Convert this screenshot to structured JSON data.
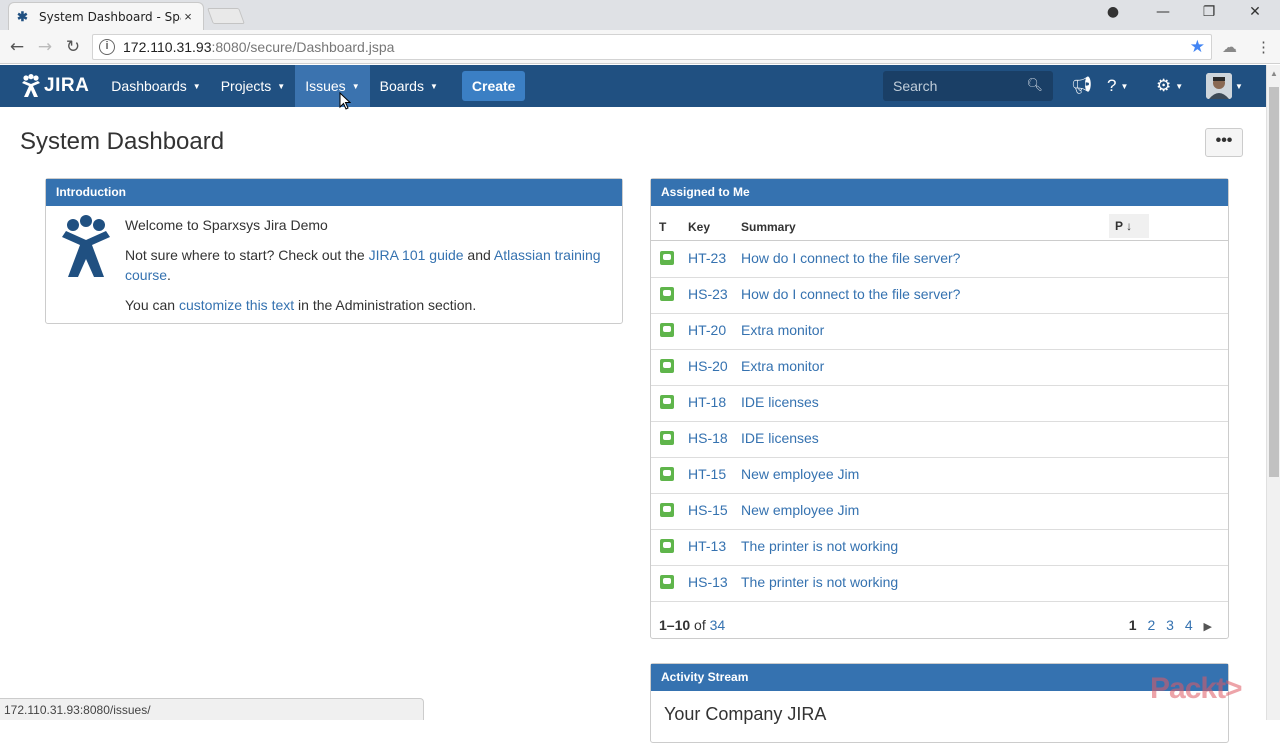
{
  "browser": {
    "tab_title": "System Dashboard - Spa",
    "tab_close": "×",
    "url_host": "172.110.31.93",
    "url_path": ":8080/secure/Dashboard.jspa",
    "status_url": "172.110.31.93:8080/issues/"
  },
  "header": {
    "logo": "JIRA",
    "nav": [
      {
        "label": "Dashboards"
      },
      {
        "label": "Projects"
      },
      {
        "label": "Issues"
      },
      {
        "label": "Boards"
      }
    ],
    "create_label": "Create",
    "search_placeholder": "Search",
    "colors": {
      "bar": "#205081",
      "active": "#3b73af",
      "create": "#3b7fc4"
    }
  },
  "page": {
    "title": "System Dashboard",
    "more_label": "•••"
  },
  "introduction": {
    "heading": "Introduction",
    "welcome": "Welcome to Sparxsys Jira Demo",
    "line2_a": "Not sure where to start? Check out the ",
    "link_guide": "JIRA 101 guide",
    "line2_b": " and ",
    "link_training": "Atlassian training course",
    "line2_c": ".",
    "line3_a": "You can ",
    "link_customize": "customize this text",
    "line3_b": " in the Administration section."
  },
  "assigned": {
    "heading": "Assigned to Me",
    "columns": {
      "type": "T",
      "key": "Key",
      "summary": "Summary",
      "priority": "P"
    },
    "rows": [
      {
        "key": "HT-23",
        "summary": "How do I connect to the file server?"
      },
      {
        "key": "HS-23",
        "summary": "How do I connect to the file server?"
      },
      {
        "key": "HT-20",
        "summary": "Extra monitor"
      },
      {
        "key": "HS-20",
        "summary": "Extra monitor"
      },
      {
        "key": "HT-18",
        "summary": "IDE licenses"
      },
      {
        "key": "HS-18",
        "summary": "IDE licenses"
      },
      {
        "key": "HT-15",
        "summary": "New employee Jim"
      },
      {
        "key": "HS-15",
        "summary": "New employee Jim"
      },
      {
        "key": "HT-13",
        "summary": "The printer is not working"
      },
      {
        "key": "HS-13",
        "summary": "The printer is not working"
      }
    ],
    "range": "1–10",
    "of": "of",
    "total": "34",
    "pages": [
      "1",
      "2",
      "3",
      "4"
    ],
    "next": "▶"
  },
  "activity": {
    "heading": "Activity Stream",
    "title": "Your Company JIRA"
  },
  "watermark": "Packt>"
}
